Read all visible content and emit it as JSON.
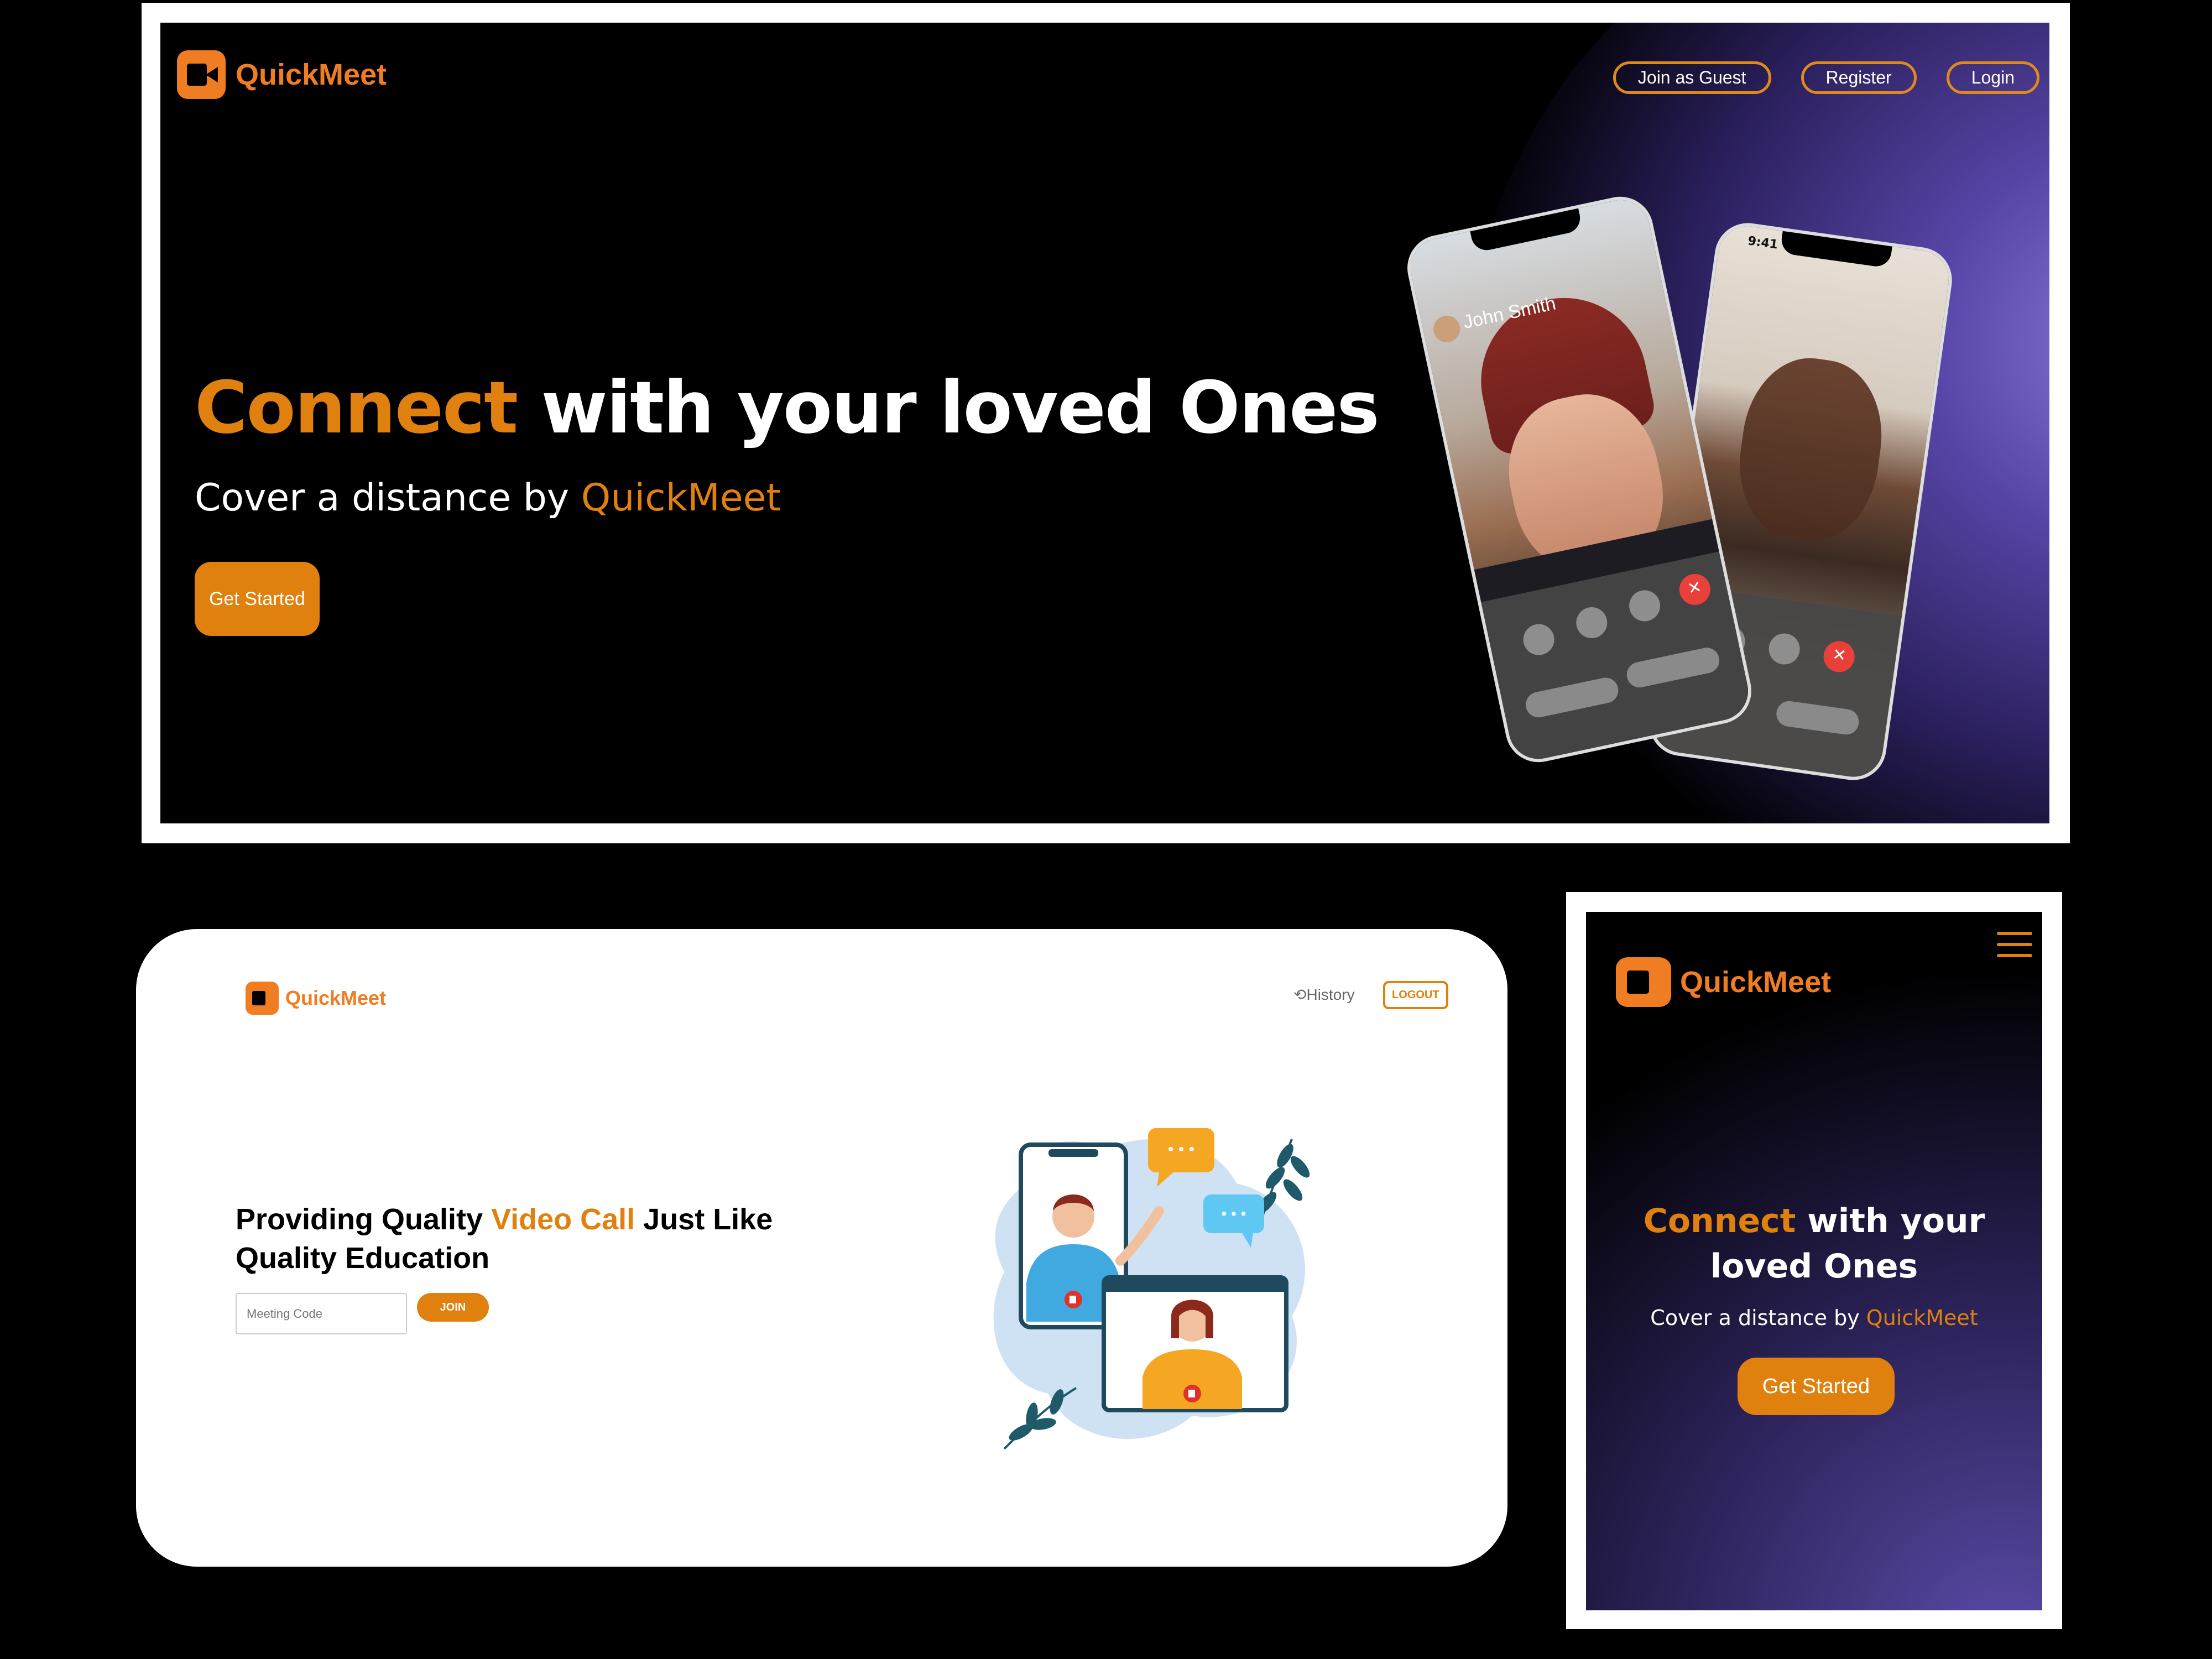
{
  "brand": {
    "name": "QuickMeet",
    "accent": "#e0810f",
    "logo_icon": "video-camera-icon"
  },
  "desktop_landing": {
    "nav": [
      "Join as Guest",
      "Register",
      "Login"
    ],
    "headline_accent": "Connect",
    "headline_rest": " with your loved Ones",
    "subtitle_prefix": "Cover a distance by ",
    "subtitle_accent": "QuickMeet",
    "cta": "Get Started",
    "phone_caller": "John Smith",
    "phone_time": "9:41"
  },
  "app_home": {
    "history_icon": "history-icon",
    "history_label": "History",
    "logout_label": "LOGOUT",
    "headline_a": "Providing Quality ",
    "headline_accent": "Video Call",
    "headline_b": " Just Like Quality Education",
    "meeting_placeholder": "Meeting Code",
    "join_label": "JOIN"
  },
  "mobile_landing": {
    "menu_icon": "hamburger-menu-icon",
    "headline_accent": "Connect",
    "headline_rest": " with your loved Ones",
    "subtitle_prefix": "Cover a distance by ",
    "subtitle_accent": "QuickMeet",
    "cta": "Get Started"
  }
}
